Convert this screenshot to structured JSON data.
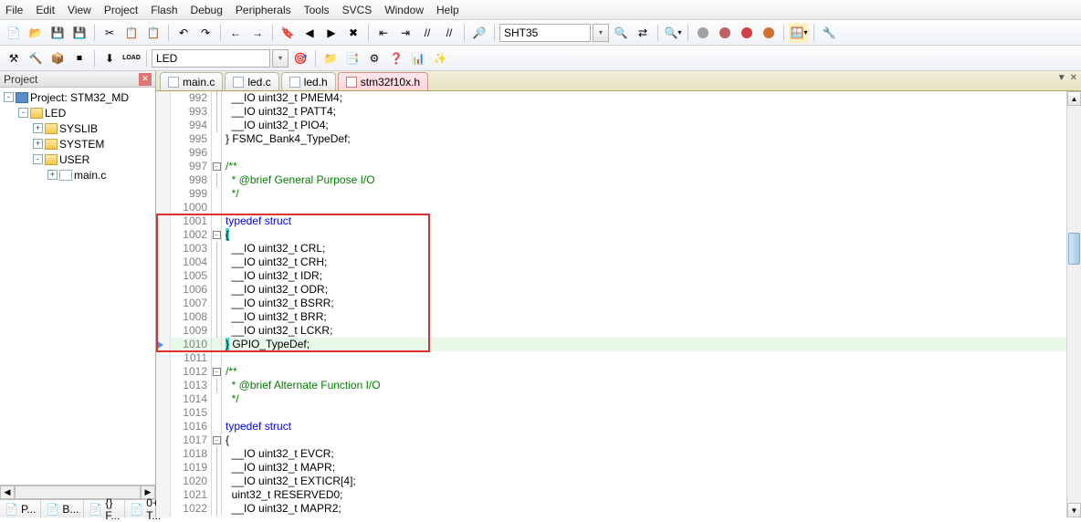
{
  "menu": {
    "items": [
      "File",
      "Edit",
      "View",
      "Project",
      "Flash",
      "Debug",
      "Peripherals",
      "Tools",
      "SVCS",
      "Window",
      "Help"
    ]
  },
  "toolbar1": {
    "search_value": "SHT35",
    "icons": [
      "new",
      "open",
      "save",
      "saveall",
      "cut",
      "copy",
      "paste",
      "undo",
      "redo",
      "back",
      "forward",
      "bookmark",
      "bookmark-prev",
      "bookmark-next",
      "bookmark-clear",
      "indent-left",
      "indent-right",
      "comment",
      "uncomment",
      "find",
      "search-dd",
      "find-in-files",
      "replace",
      "zoom",
      "config",
      "stop",
      "record",
      "erase",
      "debug",
      "view-dd",
      "settings"
    ]
  },
  "toolbar2": {
    "target_value": "LED",
    "icons": [
      "build",
      "rebuild",
      "batch",
      "stop",
      "download",
      "load",
      "target-dd",
      "options",
      "target-options",
      "manage",
      "include",
      "help",
      "analyze"
    ]
  },
  "panel": {
    "title": "Project",
    "root": "Project: STM32_MD",
    "target": "LED",
    "groups": [
      {
        "name": "SYSLIB",
        "exp": "+"
      },
      {
        "name": "SYSTEM",
        "exp": "+"
      },
      {
        "name": "USER",
        "exp": "-",
        "files": [
          "main.c"
        ]
      }
    ],
    "tabs": [
      "P...",
      "B...",
      "{} F...",
      "0+ T..."
    ]
  },
  "editor": {
    "tabs": [
      {
        "label": "main.c",
        "active": false
      },
      {
        "label": "led.c",
        "active": false
      },
      {
        "label": "led.h",
        "active": false
      },
      {
        "label": "stm32f10x.h",
        "active": true
      }
    ],
    "lines": [
      {
        "n": 992,
        "text": "  __IO uint32_t PMEM4;",
        "fold": "|"
      },
      {
        "n": 993,
        "text": "  __IO uint32_t PATT4;",
        "fold": "|"
      },
      {
        "n": 994,
        "text": "  __IO uint32_t PIO4;",
        "fold": "|"
      },
      {
        "n": 995,
        "text": "} FSMC_Bank4_TypeDef;",
        "fold": ""
      },
      {
        "n": 996,
        "text": "",
        "fold": ""
      },
      {
        "n": 997,
        "text": "/**",
        "fold": "[-]",
        "cls": "cm"
      },
      {
        "n": 998,
        "text": "  * @brief General Purpose I/O",
        "fold": "|",
        "cls": "cm"
      },
      {
        "n": 999,
        "text": "  */",
        "fold": "",
        "cls": "cm"
      },
      {
        "n": 1000,
        "text": "",
        "fold": ""
      },
      {
        "n": 1001,
        "text": "typedef struct",
        "fold": "",
        "cls": "kw",
        "box": "top"
      },
      {
        "n": 1002,
        "text": "{",
        "fold": "[-]",
        "hlopen": true,
        "box": "mid"
      },
      {
        "n": 1003,
        "text": "  __IO uint32_t CRL;",
        "fold": "|",
        "box": "mid"
      },
      {
        "n": 1004,
        "text": "  __IO uint32_t CRH;",
        "fold": "|",
        "box": "mid"
      },
      {
        "n": 1005,
        "text": "  __IO uint32_t IDR;",
        "fold": "|",
        "box": "mid"
      },
      {
        "n": 1006,
        "text": "  __IO uint32_t ODR;",
        "fold": "|",
        "box": "mid"
      },
      {
        "n": 1007,
        "text": "  __IO uint32_t BSRR;",
        "fold": "|",
        "box": "mid"
      },
      {
        "n": 1008,
        "text": "  __IO uint32_t BRR;",
        "fold": "|",
        "box": "mid"
      },
      {
        "n": 1009,
        "text": "  __IO uint32_t LCKR;",
        "fold": "|",
        "box": "mid"
      },
      {
        "n": 1010,
        "text": "} GPIO_TypeDef;",
        "fold": "",
        "hlclose": true,
        "highlight": true,
        "arrow": true,
        "box": "bot"
      },
      {
        "n": 1011,
        "text": "",
        "fold": ""
      },
      {
        "n": 1012,
        "text": "/**",
        "fold": "[-]",
        "cls": "cm"
      },
      {
        "n": 1013,
        "text": "  * @brief Alternate Function I/O",
        "fold": "|",
        "cls": "cm"
      },
      {
        "n": 1014,
        "text": "  */",
        "fold": "",
        "cls": "cm"
      },
      {
        "n": 1015,
        "text": "",
        "fold": ""
      },
      {
        "n": 1016,
        "text": "typedef struct",
        "fold": "",
        "cls": "kw"
      },
      {
        "n": 1017,
        "text": "{",
        "fold": "[-]"
      },
      {
        "n": 1018,
        "text": "  __IO uint32_t EVCR;",
        "fold": "|"
      },
      {
        "n": 1019,
        "text": "  __IO uint32_t MAPR;",
        "fold": "|"
      },
      {
        "n": 1020,
        "text": "  __IO uint32_t EXTICR[4];",
        "fold": "|"
      },
      {
        "n": 1021,
        "text": "  uint32_t RESERVED0;",
        "fold": "|"
      },
      {
        "n": 1022,
        "text": "  __IO uint32_t MAPR2;",
        "fold": "|"
      }
    ],
    "scrollbar": {
      "thumb_top_pct": 32,
      "thumb_h_pct": 8
    }
  },
  "icon_glyphs": {
    "new": "📄",
    "open": "📂",
    "save": "💾",
    "saveall": "💾",
    "cut": "✂",
    "copy": "📋",
    "paste": "📋",
    "undo": "↶",
    "redo": "↷",
    "back": "←",
    "forward": "→",
    "bookmark": "🔖",
    "bookmark-prev": "◀",
    "bookmark-next": "▶",
    "bookmark-clear": "✖",
    "indent-left": "⇤",
    "indent-right": "⇥",
    "comment": "//",
    "uncomment": "//",
    "find": "🔍",
    "search-dd": "▾",
    "find-in-files": "🔎",
    "replace": "⇄",
    "zoom": "🔍",
    "config": "⚙",
    "stop": "⏹",
    "record": "⏺",
    "erase": "⌫",
    "debug": "🐞",
    "view-dd": "▾",
    "settings": "🔧",
    "build": "⚒",
    "rebuild": "🔨",
    "batch": "📦",
    "download": "⬇",
    "load": "LOAD",
    "target-dd": "▾",
    "options": "⚙",
    "target-options": "🎯",
    "manage": "📁",
    "include": "📑",
    "help": "❓",
    "analyze": "📊",
    "magic": "✨"
  }
}
